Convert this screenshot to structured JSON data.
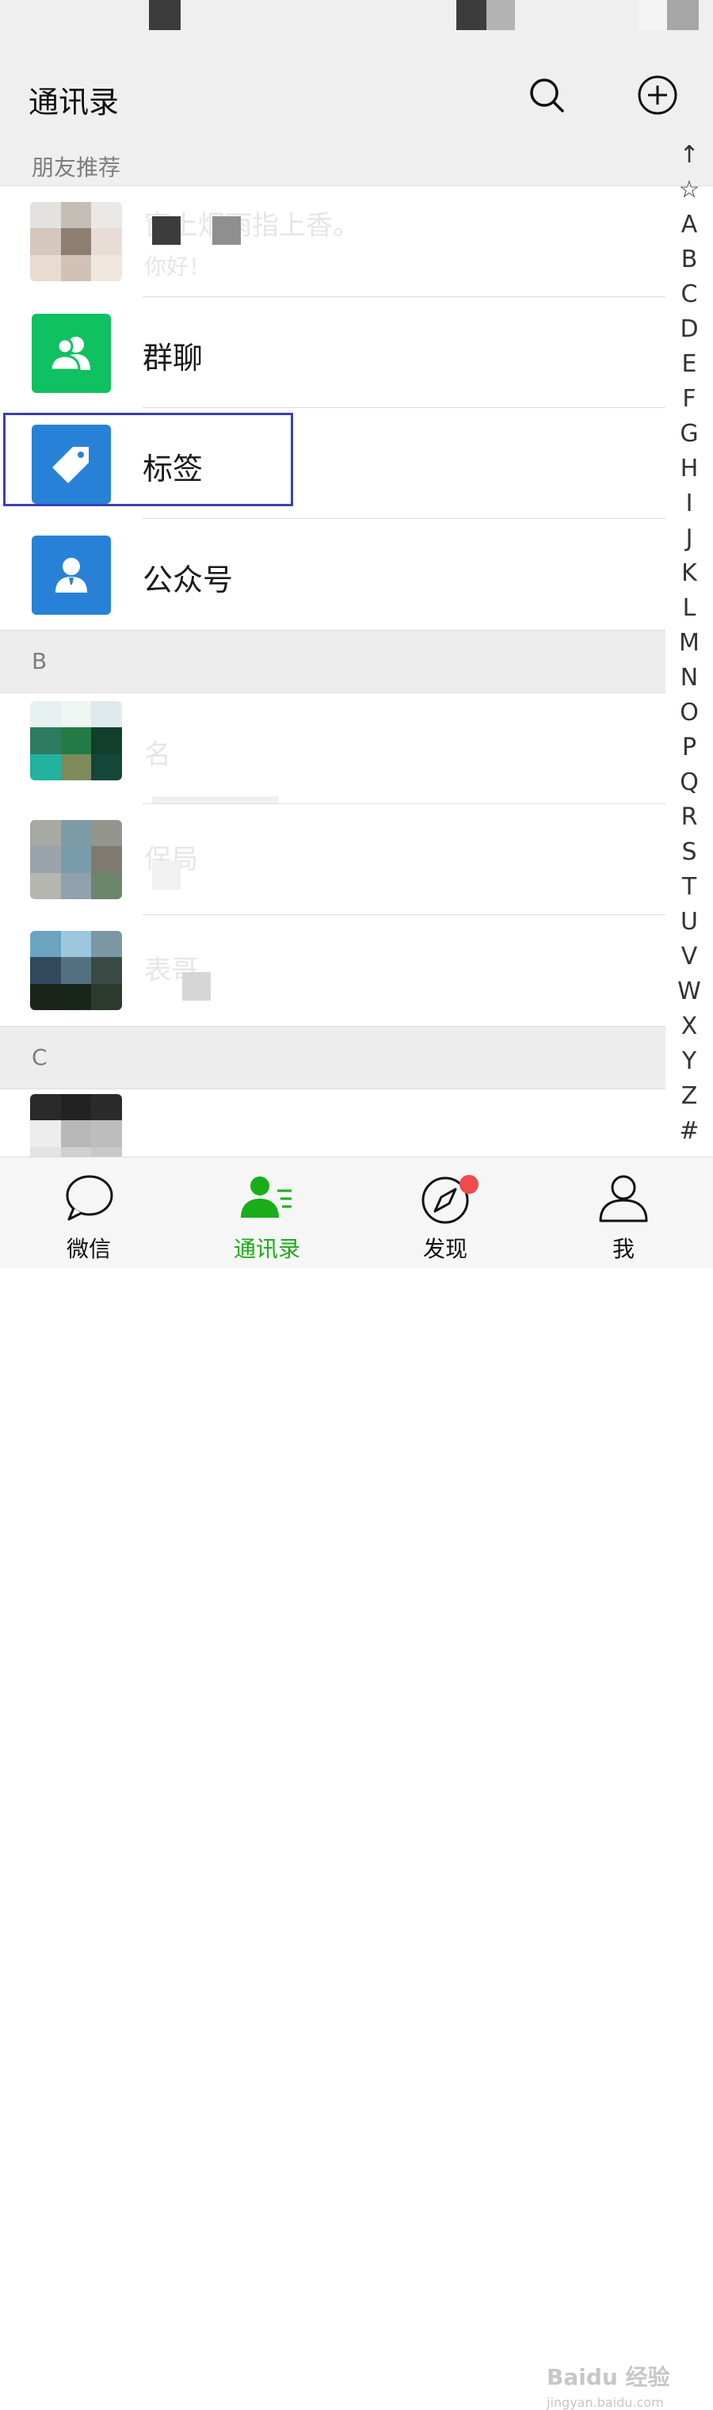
{
  "header": {
    "title": "通讯录"
  },
  "sections": {
    "recommend": "朋友推荐",
    "b": "B",
    "c": "C"
  },
  "friend_recommend": {
    "name": "窗上烟雨指上香。",
    "message": "你好！"
  },
  "menu": {
    "group_chat": "群聊",
    "tags": "标签",
    "official_accounts": "公众号"
  },
  "contacts_b": [
    "名",
    "保局",
    "表哥"
  ],
  "index_letters": [
    "↑",
    "☆",
    "A",
    "B",
    "C",
    "D",
    "E",
    "F",
    "G",
    "H",
    "I",
    "J",
    "K",
    "L",
    "M",
    "N",
    "O",
    "P",
    "Q",
    "R",
    "S",
    "T",
    "U",
    "V",
    "W",
    "X",
    "Y",
    "Z",
    "#"
  ],
  "tabs": [
    {
      "label": "微信",
      "icon": "chat-bubble-icon"
    },
    {
      "label": "通讯录",
      "icon": "contacts-icon",
      "active": true
    },
    {
      "label": "发现",
      "icon": "compass-icon",
      "badge": true
    },
    {
      "label": "我",
      "icon": "person-icon"
    }
  ],
  "watermark": {
    "brand": "Baidu 经验",
    "url": "jingyan.baidu.com"
  },
  "colors": {
    "accent_green": "#1aad19",
    "group_chat_tile": "#0fc160",
    "tag_tile": "#2782d7",
    "highlight_box": "#3b3fb5",
    "badge": "#f04a4a"
  }
}
